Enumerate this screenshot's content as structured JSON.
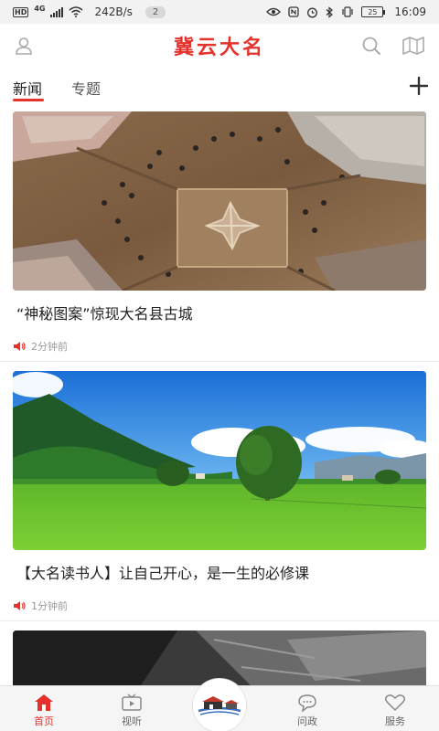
{
  "status_bar": {
    "hd": "HD",
    "network": "4G",
    "speed": "242B/s",
    "badge": "2",
    "battery": "25",
    "time": "16:09"
  },
  "header": {
    "title": "冀云大名",
    "icons": [
      "user-icon",
      "search-icon",
      "map-icon"
    ]
  },
  "tabs": {
    "items": [
      {
        "label": "新闻",
        "active": true
      },
      {
        "label": "专题",
        "active": false
      }
    ],
    "add_icon": "plus-icon"
  },
  "feed": [
    {
      "title": "“神秘图案”惊现大名县古城",
      "time": "2分钟前",
      "image": "aerial excavation site"
    },
    {
      "title": "【大名读书人】让自己开心，是一生的必修课",
      "time": "1分钟前",
      "image": "green meadow with tree"
    }
  ],
  "bottom_nav": {
    "items": [
      {
        "label": "首页",
        "icon": "home-icon",
        "active": true
      },
      {
        "label": "视听",
        "icon": "video-icon",
        "active": false
      },
      {
        "label": "问政",
        "icon": "chat-icon",
        "active": false
      },
      {
        "label": "服务",
        "icon": "heart-icon",
        "active": false
      }
    ],
    "center_icon": "city-gate-logo-icon"
  },
  "colors": {
    "accent": "#e5322d",
    "text": "#222222",
    "meta": "#999999"
  }
}
